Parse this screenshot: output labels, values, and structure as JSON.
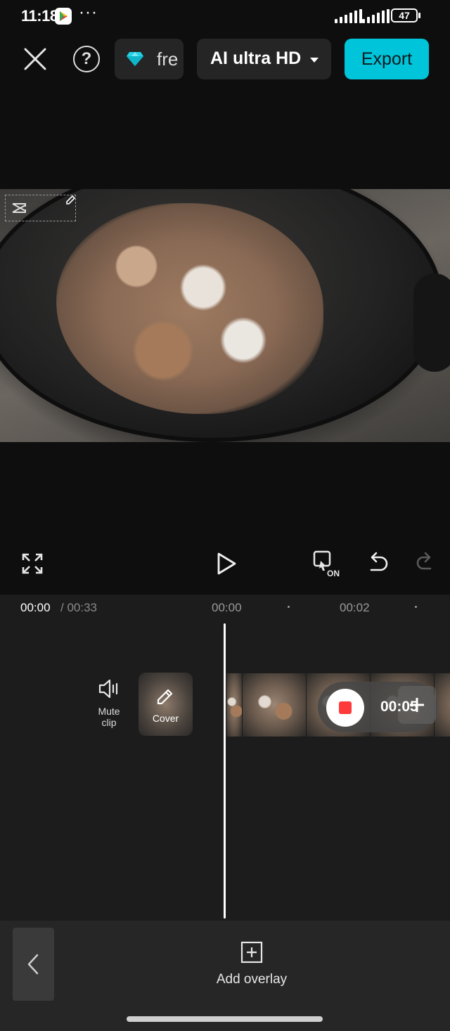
{
  "status_bar": {
    "time": "11:18",
    "overflow": "···",
    "battery": "47"
  },
  "toolbar": {
    "free_label": "fre",
    "quality_label": "AI ultra HD",
    "export_label": "Export",
    "icons": [
      "close-icon",
      "help-icon",
      "diamond-icon",
      "chevron-down-icon"
    ]
  },
  "timeline": {
    "current_time": "00:00",
    "total_time": "/ 00:33",
    "ticks": [
      "00:00",
      "00:02"
    ],
    "mute_label_1": "Mute",
    "mute_label_2": "clip",
    "cover_label": "Cover",
    "record_time": "00:05"
  },
  "bottom": {
    "add_overlay_label": "Add overlay"
  },
  "colors": {
    "accent": "#00c4d9",
    "record": "#ff3a3a",
    "background": "#0e0e0e",
    "panel": "#1c1c1c"
  }
}
